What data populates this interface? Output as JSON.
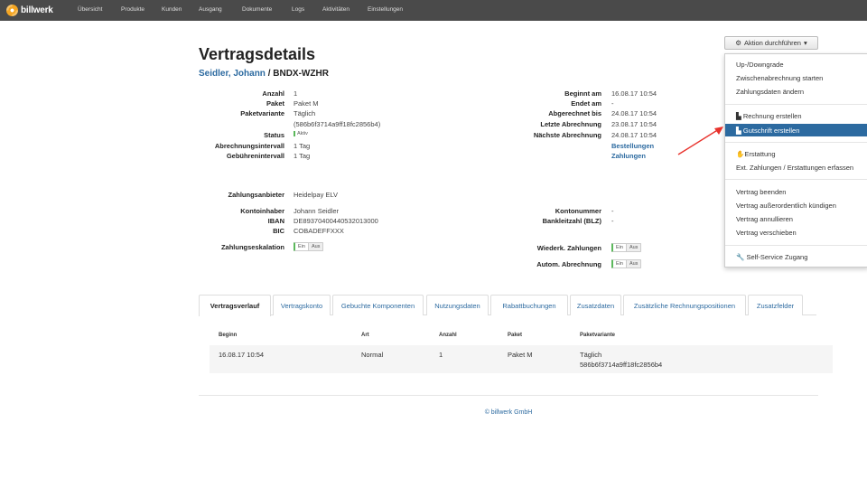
{
  "nav": {
    "logo_text": "billwerk",
    "items": [
      "Übersicht",
      "Produkte",
      "Kunden",
      "Ausgang",
      "Dokumente",
      "Logs",
      "Aktivitäten",
      "Einstellungen"
    ]
  },
  "page": {
    "title": "Vertragsdetails",
    "customer_name": "Seidler, Johann",
    "contract_id": " / BNDX-WZHR"
  },
  "details_left": {
    "anzahl_label": "Anzahl",
    "anzahl": "1",
    "paket_label": "Paket",
    "paket": "Paket M",
    "variante_label": "Paketvariante",
    "variante": "Täglich",
    "variante_id": "(586b6f3714a9ff18fc2856b4)",
    "status_label": "Status",
    "status": "Aktiv",
    "abrechnung_label": "Abrechnungsintervall",
    "abrechnung": "1 Tag",
    "gebuehren_label": "Gebührenintervall",
    "gebuehren": "1 Tag"
  },
  "details_right": {
    "beginn_label": "Beginnt am",
    "beginn": "16.08.17 10:54",
    "endet_label": "Endet am",
    "endet": "-",
    "abgerechnet_label": "Abgerechnet bis",
    "abgerechnet": "24.08.17 10:54",
    "letzte_label": "Letzte Abrechnung",
    "letzte": "23.08.17 10:54",
    "naechste_label": "Nächste Abrechnung",
    "naechste": "24.08.17 10:54",
    "bestellungen": "Bestellungen",
    "zahlungen": "Zahlungen"
  },
  "payment": {
    "anbieter_label": "Zahlungsanbieter",
    "anbieter": "Heidelpay ELV",
    "inhaber_label": "Kontoinhaber",
    "inhaber": "Johann Seidler",
    "iban_label": "IBAN",
    "iban": "DE89370400440532013000",
    "bic_label": "BIC",
    "bic": "COBADEFFXXX",
    "eskalation_label": "Zahlungseskalation",
    "kontonummer_label": "Kontonummer",
    "kontonummer": "-",
    "blz_label": "Bankleitzahl (BLZ)",
    "blz": "-",
    "wiederk_label": "Wiederk. Zahlungen",
    "autom_label": "Autom. Abrechnung",
    "toggle_on": "Ein",
    "toggle_off": "Aus"
  },
  "action": {
    "button_label": "Aktion durchführen",
    "items": [
      "Up-/Downgrade",
      "Zwischenabrechnung starten",
      "Zahlungsdaten ändern",
      "Rechnung erstellen",
      "Gutschrift erstellen",
      "Erstattung",
      "Ext. Zahlungen / Erstattungen erfassen",
      "Vertrag beenden",
      "Vertrag außerordentlich kündigen",
      "Vertrag annullieren",
      "Vertrag verschieben",
      "Self-Service Zugang"
    ]
  },
  "tabs": [
    "Vertragsverlauf",
    "Vertragskonto",
    "Gebuchte Komponenten",
    "Nutzungsdaten",
    "Rabattbuchungen",
    "Zusatzdaten",
    "Zusätzliche Rechnungspositionen",
    "Zusatzfelder"
  ],
  "history": {
    "headers": [
      "Beginn",
      "Art",
      "Anzahl",
      "Paket",
      "Paketvariante"
    ],
    "rows": [
      {
        "beginn": "16.08.17 10:54",
        "art": "Normal",
        "anzahl": "1",
        "paket": "Paket M",
        "variante": "Täglich",
        "variante_id": "586b6f3714a9ff18fc2856b4"
      }
    ]
  },
  "footer": "© billwerk GmbH",
  "colors": {
    "nav_bg": "#4a4a4a",
    "link": "#2c6aa0",
    "active_menu": "#2c6aa0",
    "status": "#5cb85c",
    "arrow": "#e8322c"
  }
}
